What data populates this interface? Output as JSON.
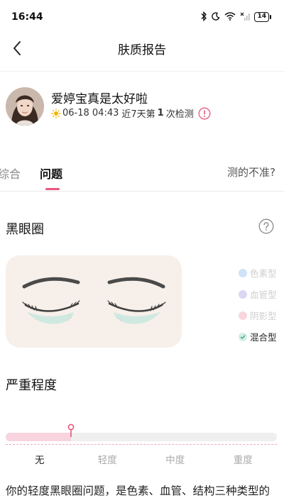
{
  "status_bar": {
    "time": "16:44",
    "battery": "14"
  },
  "nav": {
    "title": "肤质报告"
  },
  "profile": {
    "username": "爱婷宝真是太好啦",
    "date_time": "06-18 04:43",
    "recent_prefix": "近7天第",
    "recent_count": "1",
    "recent_suffix": "次检测"
  },
  "tabs": {
    "overall": "综合",
    "issues": "问题",
    "inaccurate": "测的不准?"
  },
  "dark_circles": {
    "title": "黑眼圈",
    "types": [
      {
        "label": "色素型",
        "color": "#cfe2f7",
        "active": false
      },
      {
        "label": "血管型",
        "color": "#ddd6f3",
        "active": false
      },
      {
        "label": "阴影型",
        "color": "#f8d6de",
        "active": false
      },
      {
        "label": "混合型",
        "color": "#d3efe6",
        "active": true
      }
    ],
    "card_color": "#f7efe9",
    "under_eye_color": "#cfe9e1"
  },
  "severity": {
    "title": "严重程度",
    "levels": [
      "无",
      "轻度",
      "中度",
      "重度"
    ],
    "current_level": "无",
    "value": 0.24,
    "accent": "#e8587d"
  },
  "description": "你的轻度黑眼圈问题，是色素、血管、结构三种类型的"
}
